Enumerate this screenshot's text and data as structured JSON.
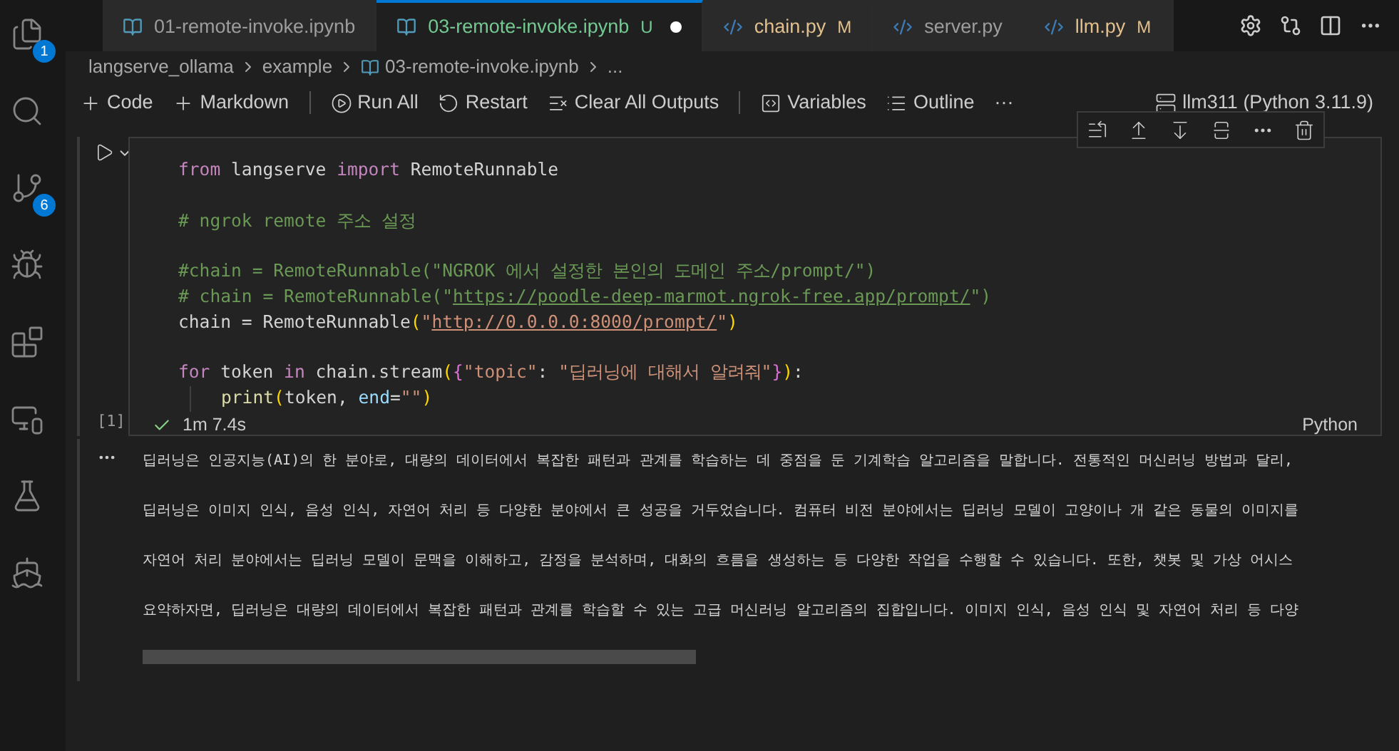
{
  "activity_bar": [
    {
      "kind": "files",
      "badge": "1"
    },
    {
      "kind": "search"
    },
    {
      "kind": "source-control",
      "badge": "6"
    },
    {
      "kind": "run-debug"
    },
    {
      "kind": "extensions"
    },
    {
      "kind": "remote"
    },
    {
      "kind": "testing"
    },
    {
      "kind": "docker"
    }
  ],
  "tabs": [
    {
      "label": "01-remote-invoke.ipynb",
      "kind": "notebook",
      "selected": false
    },
    {
      "label": "03-remote-invoke.ipynb",
      "kind": "notebook",
      "selected": true,
      "modified": true,
      "badge": "U",
      "color": "#73c991"
    },
    {
      "label": "chain.py",
      "kind": "python",
      "selected": false,
      "badge": "M",
      "color": "#e2c08d"
    },
    {
      "label": "server.py",
      "kind": "python",
      "selected": false
    },
    {
      "label": "llm.py",
      "kind": "python",
      "selected": false,
      "badge": "M",
      "color": "#e2c08d"
    }
  ],
  "breadcrumb": [
    "langserve_ollama",
    "example",
    "03-remote-invoke.ipynb",
    "..."
  ],
  "toolbar": [
    {
      "kind": "plus",
      "label": "Code"
    },
    {
      "kind": "plus",
      "label": "Markdown"
    },
    {
      "kind": "run",
      "label": "Run All"
    },
    {
      "kind": "restart",
      "label": "Restart"
    },
    {
      "kind": "clear",
      "label": "Clear All Outputs"
    },
    {
      "kind": "variables",
      "label": "Variables"
    },
    {
      "kind": "outline",
      "label": "Outline"
    },
    {
      "kind": "more",
      "label": "···"
    }
  ],
  "kernel": "llm311 (Python 3.11.9)",
  "cell": {
    "execution_count": "[1]",
    "status": "1m 7.4s",
    "language": "Python",
    "lines": [
      {
        "kind": "code",
        "tokens": [
          {
            "kind": "keyword",
            "text": "from"
          },
          {
            "kind": "plain",
            "text": " langserve "
          },
          {
            "kind": "keyword",
            "text": "import"
          },
          {
            "kind": "plain",
            "text": " RemoteRunnable"
          }
        ]
      },
      {
        "kind": "blank"
      },
      {
        "kind": "code",
        "tokens": [
          {
            "kind": "comment",
            "text": "# ngrok remote 주소 설정"
          }
        ]
      },
      {
        "kind": "blank"
      },
      {
        "kind": "code",
        "tokens": [
          {
            "kind": "comment",
            "text": "#chain = RemoteRunnable(\"NGROK 에서 설정한 본인의 도메인 주소/prompt/\")"
          }
        ]
      },
      {
        "kind": "code",
        "tokens": [
          {
            "kind": "comment",
            "text": "# chain = RemoteRunnable(\""
          },
          {
            "kind": "comment-link",
            "text": "https://poodle-deep-marmot.ngrok-free.app/prompt/"
          },
          {
            "kind": "comment",
            "text": "\")"
          }
        ]
      },
      {
        "kind": "code",
        "tokens": [
          {
            "kind": "plain",
            "text": "chain = RemoteRunnable"
          },
          {
            "kind": "bracket",
            "text": "("
          },
          {
            "kind": "string",
            "text": "\""
          },
          {
            "kind": "string-link",
            "text": "http://0.0.0.0:8000/prompt/"
          },
          {
            "kind": "string",
            "text": "\""
          },
          {
            "kind": "bracket",
            "text": ")"
          }
        ]
      },
      {
        "kind": "blank"
      },
      {
        "kind": "code",
        "tokens": [
          {
            "kind": "keyword",
            "text": "for"
          },
          {
            "kind": "plain",
            "text": " token "
          },
          {
            "kind": "keyword",
            "text": "in"
          },
          {
            "kind": "plain",
            "text": " chain.stream"
          },
          {
            "kind": "bracket",
            "text": "("
          },
          {
            "kind": "bracket2",
            "text": "{"
          },
          {
            "kind": "string",
            "text": "\"topic\""
          },
          {
            "kind": "plain",
            "text": ": "
          },
          {
            "kind": "string",
            "text": "\"딥러닝에 대해서 알려줘\""
          },
          {
            "kind": "bracket2",
            "text": "}"
          },
          {
            "kind": "bracket",
            "text": ")"
          },
          {
            "kind": "plain",
            "text": ":"
          }
        ]
      },
      {
        "kind": "indented",
        "tokens": [
          {
            "kind": "func",
            "text": "print"
          },
          {
            "kind": "bracket",
            "text": "("
          },
          {
            "kind": "plain",
            "text": "token, "
          },
          {
            "kind": "param",
            "text": "end"
          },
          {
            "kind": "plain",
            "text": "="
          },
          {
            "kind": "string",
            "text": "\"\""
          },
          {
            "kind": "bracket",
            "text": ")"
          }
        ]
      }
    ]
  },
  "output": [
    "딥러닝은 인공지능(AI)의 한 분야로, 대량의 데이터에서 복잡한 패턴과 관계를 학습하는 데 중점을 둔 기계학습 알고리즘을 말합니다. 전통적인 머신러닝 방법과 달리,",
    "딥러닝은 이미지 인식, 음성 인식, 자연어 처리 등 다양한 분야에서 큰 성공을 거두었습니다. 컴퓨터 비전 분야에서는 딥러닝 모델이 고양이나 개 같은 동물의 이미지를",
    "자연어 처리 분야에서는 딥러닝 모델이 문맥을 이해하고, 감정을 분석하며, 대화의 흐름을 생성하는 등 다양한 작업을 수행할 수 있습니다. 또한, 챗봇 및 가상 어시스",
    "요약하자면, 딥러닝은 대량의 데이터에서 복잡한 패턴과 관계를 학습할 수 있는 고급 머신러닝 알고리즘의 집합입니다. 이미지 인식, 음성 인식 및 자연어 처리 등 다양"
  ]
}
